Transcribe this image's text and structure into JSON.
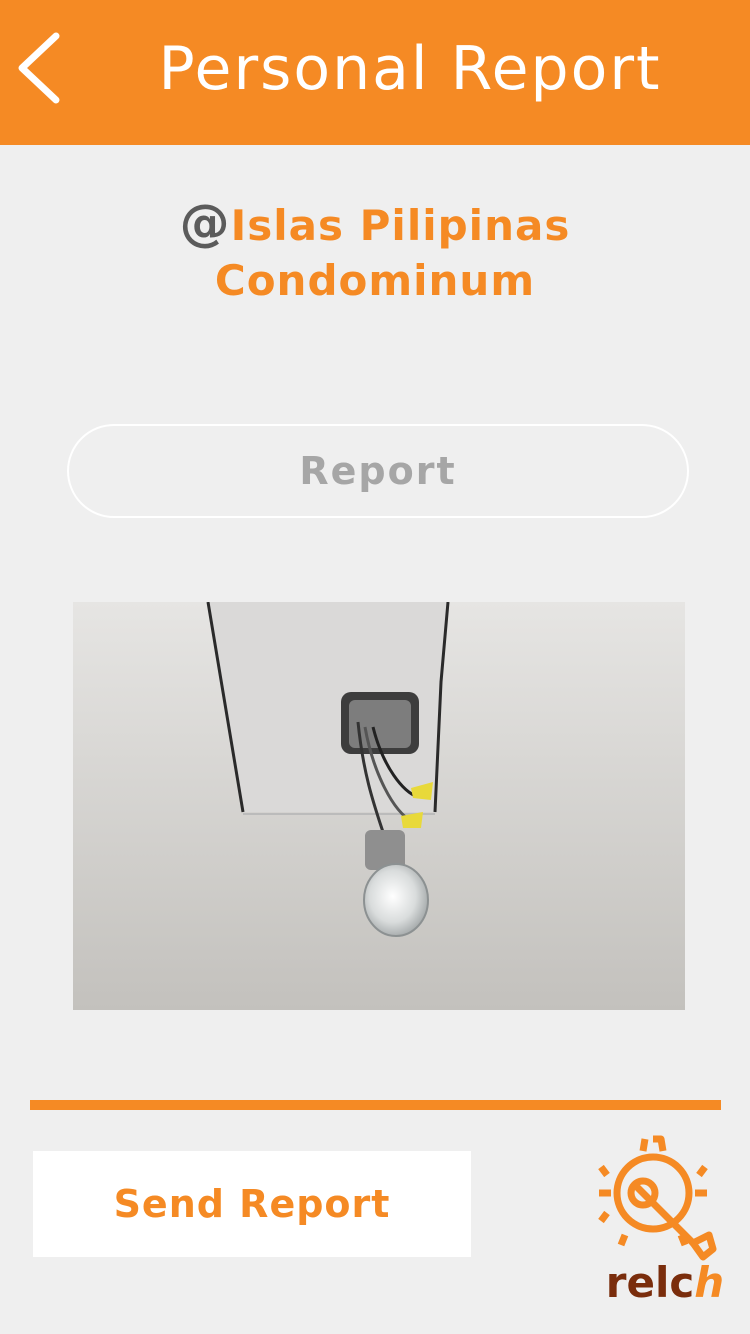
{
  "header": {
    "title": "Personal Report",
    "back_icon": "chevron-left-icon"
  },
  "location": {
    "at_symbol": "@",
    "name": "Islas Pilipinas Condominum"
  },
  "report_field": {
    "placeholder": "Report",
    "value": ""
  },
  "photo": {
    "subject": "exposed ceiling light bulb"
  },
  "actions": {
    "send_label": "Send Report"
  },
  "brand": {
    "text_main": "relc",
    "text_accent": "h",
    "icon": "gear-wrench-icon"
  },
  "colors": {
    "accent": "#f58a24",
    "background": "#efefef",
    "brand_dark": "#7a2d0c"
  }
}
